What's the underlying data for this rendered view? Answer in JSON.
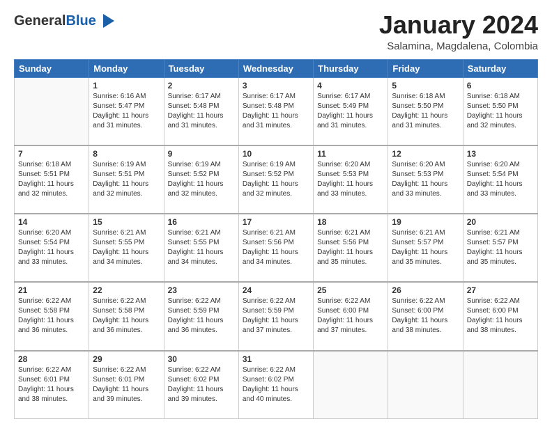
{
  "header": {
    "logo": {
      "general": "General",
      "blue": "Blue"
    },
    "title": "January 2024",
    "location": "Salamina, Magdalena, Colombia"
  },
  "weekdays": [
    "Sunday",
    "Monday",
    "Tuesday",
    "Wednesday",
    "Thursday",
    "Friday",
    "Saturday"
  ],
  "weeks": [
    [
      {
        "day": "",
        "empty": true
      },
      {
        "day": "1",
        "sunrise": "6:16 AM",
        "sunset": "5:47 PM",
        "daylight": "11 hours and 31 minutes."
      },
      {
        "day": "2",
        "sunrise": "6:17 AM",
        "sunset": "5:48 PM",
        "daylight": "11 hours and 31 minutes."
      },
      {
        "day": "3",
        "sunrise": "6:17 AM",
        "sunset": "5:48 PM",
        "daylight": "11 hours and 31 minutes."
      },
      {
        "day": "4",
        "sunrise": "6:17 AM",
        "sunset": "5:49 PM",
        "daylight": "11 hours and 31 minutes."
      },
      {
        "day": "5",
        "sunrise": "6:18 AM",
        "sunset": "5:50 PM",
        "daylight": "11 hours and 31 minutes."
      },
      {
        "day": "6",
        "sunrise": "6:18 AM",
        "sunset": "5:50 PM",
        "daylight": "11 hours and 32 minutes."
      }
    ],
    [
      {
        "day": "7",
        "sunrise": "6:18 AM",
        "sunset": "5:51 PM",
        "daylight": "11 hours and 32 minutes."
      },
      {
        "day": "8",
        "sunrise": "6:19 AM",
        "sunset": "5:51 PM",
        "daylight": "11 hours and 32 minutes."
      },
      {
        "day": "9",
        "sunrise": "6:19 AM",
        "sunset": "5:52 PM",
        "daylight": "11 hours and 32 minutes."
      },
      {
        "day": "10",
        "sunrise": "6:19 AM",
        "sunset": "5:52 PM",
        "daylight": "11 hours and 32 minutes."
      },
      {
        "day": "11",
        "sunrise": "6:20 AM",
        "sunset": "5:53 PM",
        "daylight": "11 hours and 33 minutes."
      },
      {
        "day": "12",
        "sunrise": "6:20 AM",
        "sunset": "5:53 PM",
        "daylight": "11 hours and 33 minutes."
      },
      {
        "day": "13",
        "sunrise": "6:20 AM",
        "sunset": "5:54 PM",
        "daylight": "11 hours and 33 minutes."
      }
    ],
    [
      {
        "day": "14",
        "sunrise": "6:20 AM",
        "sunset": "5:54 PM",
        "daylight": "11 hours and 33 minutes."
      },
      {
        "day": "15",
        "sunrise": "6:21 AM",
        "sunset": "5:55 PM",
        "daylight": "11 hours and 34 minutes."
      },
      {
        "day": "16",
        "sunrise": "6:21 AM",
        "sunset": "5:55 PM",
        "daylight": "11 hours and 34 minutes."
      },
      {
        "day": "17",
        "sunrise": "6:21 AM",
        "sunset": "5:56 PM",
        "daylight": "11 hours and 34 minutes."
      },
      {
        "day": "18",
        "sunrise": "6:21 AM",
        "sunset": "5:56 PM",
        "daylight": "11 hours and 35 minutes."
      },
      {
        "day": "19",
        "sunrise": "6:21 AM",
        "sunset": "5:57 PM",
        "daylight": "11 hours and 35 minutes."
      },
      {
        "day": "20",
        "sunrise": "6:21 AM",
        "sunset": "5:57 PM",
        "daylight": "11 hours and 35 minutes."
      }
    ],
    [
      {
        "day": "21",
        "sunrise": "6:22 AM",
        "sunset": "5:58 PM",
        "daylight": "11 hours and 36 minutes."
      },
      {
        "day": "22",
        "sunrise": "6:22 AM",
        "sunset": "5:58 PM",
        "daylight": "11 hours and 36 minutes."
      },
      {
        "day": "23",
        "sunrise": "6:22 AM",
        "sunset": "5:59 PM",
        "daylight": "11 hours and 36 minutes."
      },
      {
        "day": "24",
        "sunrise": "6:22 AM",
        "sunset": "5:59 PM",
        "daylight": "11 hours and 37 minutes."
      },
      {
        "day": "25",
        "sunrise": "6:22 AM",
        "sunset": "6:00 PM",
        "daylight": "11 hours and 37 minutes."
      },
      {
        "day": "26",
        "sunrise": "6:22 AM",
        "sunset": "6:00 PM",
        "daylight": "11 hours and 38 minutes."
      },
      {
        "day": "27",
        "sunrise": "6:22 AM",
        "sunset": "6:00 PM",
        "daylight": "11 hours and 38 minutes."
      }
    ],
    [
      {
        "day": "28",
        "sunrise": "6:22 AM",
        "sunset": "6:01 PM",
        "daylight": "11 hours and 38 minutes."
      },
      {
        "day": "29",
        "sunrise": "6:22 AM",
        "sunset": "6:01 PM",
        "daylight": "11 hours and 39 minutes."
      },
      {
        "day": "30",
        "sunrise": "6:22 AM",
        "sunset": "6:02 PM",
        "daylight": "11 hours and 39 minutes."
      },
      {
        "day": "31",
        "sunrise": "6:22 AM",
        "sunset": "6:02 PM",
        "daylight": "11 hours and 40 minutes."
      },
      {
        "day": "",
        "empty": true
      },
      {
        "day": "",
        "empty": true
      },
      {
        "day": "",
        "empty": true
      }
    ]
  ]
}
